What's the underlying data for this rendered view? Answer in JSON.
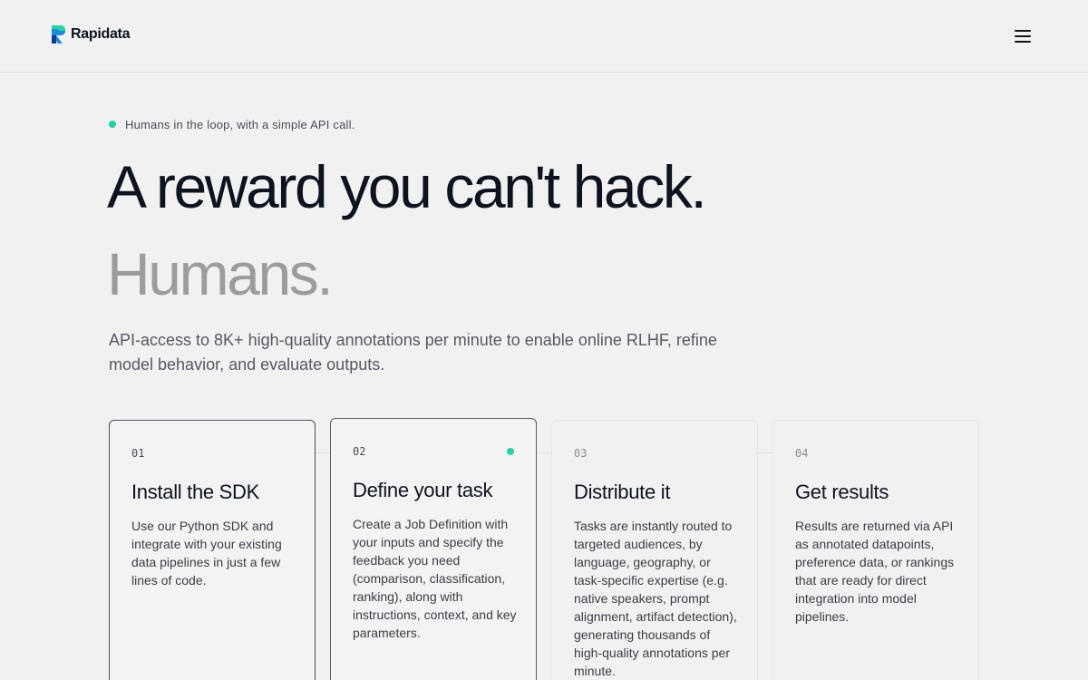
{
  "header": {
    "brand": "Rapidata",
    "accent_color": "#22d3a6",
    "menu_icon": "hamburger-menu-icon"
  },
  "hero": {
    "eyebrow": "Humans in the loop, with a simple API call.",
    "title": "A reward you can't hack.",
    "subtitle": "Humans.",
    "lead": "API-access to 8K+ high-quality annotations per minute to enable online RLHF, refine model behavior, and evaluate outputs."
  },
  "steps": [
    {
      "number": "01",
      "title": "Install the SDK",
      "text": "Use our Python SDK and integrate with your existing data pipelines in just a few lines of code."
    },
    {
      "number": "02",
      "title": "Define your task",
      "text": "Create a Job Definition with your inputs and specify the feedback you need (comparison, classification, ranking), along with instructions, context, and key parameters."
    },
    {
      "number": "03",
      "title": "Distribute it",
      "text": "Tasks are instantly routed to targeted audiences, by language, geography, or task-specific expertise (e.g. native speakers, prompt alignment, artifact detection), generating thousands of high-quality annotations per minute."
    },
    {
      "number": "04",
      "title": "Get results",
      "text": "Results are returned via API as annotated datapoints, preference data, or rankings that are ready for direct integration into model pipelines."
    }
  ]
}
